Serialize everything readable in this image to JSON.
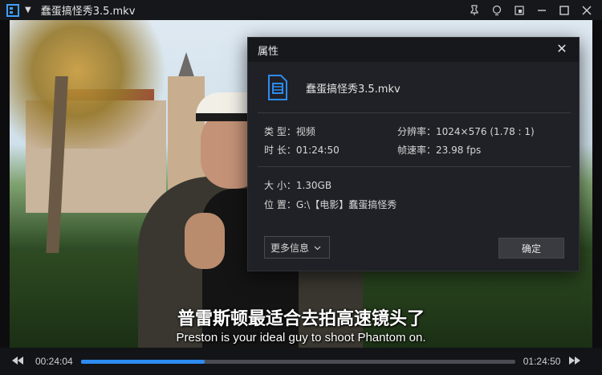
{
  "titlebar": {
    "title": "蠢蛋搞怪秀3.5.mkv",
    "caret": "▼",
    "actions": [
      "pin-icon",
      "bulb-icon",
      "mini-mode-icon",
      "minimize-icon",
      "maximize-icon",
      "close-icon"
    ]
  },
  "video": {
    "subtitle_zh": "普雷斯顿最适合去拍高速镜头了",
    "subtitle_en": "Preston is your ideal guy to shoot Phantom on."
  },
  "controls": {
    "current_time": "00:24:04",
    "total_time": "01:24:50",
    "progress": 0.285,
    "accent": "#2d8cf0"
  },
  "dialog": {
    "title": "属性",
    "close": "✕",
    "file_name": "蠢蛋搞怪秀3.5.mkv",
    "type": "类 型：视频",
    "duration": "时 长：01:24:50",
    "resolution": "分辨率：1024×576 (1.78 : 1)",
    "framerate": "帧速率：23.98 fps",
    "size": "大 小：1.30GB",
    "location": "位 置：G:\\【电影】蠢蛋搞怪秀",
    "more_info": "更多信息",
    "ok": "确定"
  }
}
